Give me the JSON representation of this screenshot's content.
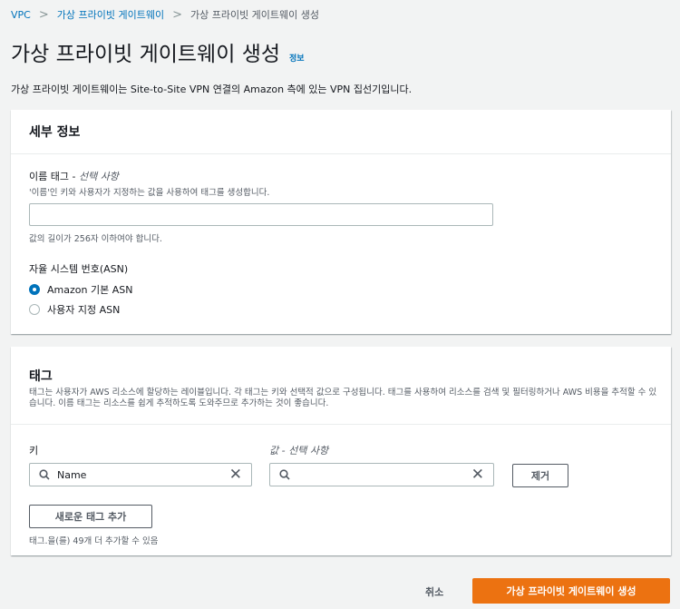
{
  "breadcrumb": {
    "items": [
      "VPC",
      "가상 프라이빗 게이트웨이",
      "가상 프라이빗 게이트웨이 생성"
    ],
    "separator": ">"
  },
  "page": {
    "title": "가상 프라이빗 게이트웨이 생성",
    "info_link": "정보",
    "description": "가상 프라이빗 게이트웨이는 Site-to-Site VPN 연결의 Amazon 측에 있는 VPN 집선기입니다."
  },
  "details": {
    "title": "세부 정보",
    "name_tag": {
      "label": "이름 태그 - ",
      "optional": "선택 사항",
      "description": "'이름'인 키와 사용자가 지정하는 값을 사용하여 태그를 생성합니다.",
      "value": "",
      "constraint": "값의 길이가 256자 이하여야 합니다."
    },
    "asn": {
      "label": "자율 시스템 번호(ASN)",
      "options": [
        {
          "label": "Amazon 기본 ASN",
          "selected": true
        },
        {
          "label": "사용자 지정 ASN",
          "selected": false
        }
      ]
    }
  },
  "tags": {
    "title": "태그",
    "description": "태그는 사용자가 AWS 리소스에 할당하는 레이블입니다. 각 태그는 키와 선택적 값으로 구성됩니다. 태그를 사용하여 리소스를 검색 및 필터링하거나 AWS 비용을 추적할 수 있습니다. 이름 태그는 리소스를 쉽게 추적하도록 도와주므로 추가하는 것이 좋습니다.",
    "key_label": "키",
    "value_label": "값 - ",
    "value_optional": "선택 사항",
    "rows": [
      {
        "key": "Name",
        "value": ""
      }
    ],
    "remove_label": "제거",
    "add_label": "새로운 태그 추가",
    "limit_text": "태그.을(를) 49개 더 추가할 수 있음"
  },
  "footer": {
    "cancel_label": "취소",
    "submit_label": "가상 프라이빗 게이트웨이 생성"
  },
  "colors": {
    "link": "#0073bb",
    "primary": "#ec7211",
    "background": "#f2f3f3"
  }
}
